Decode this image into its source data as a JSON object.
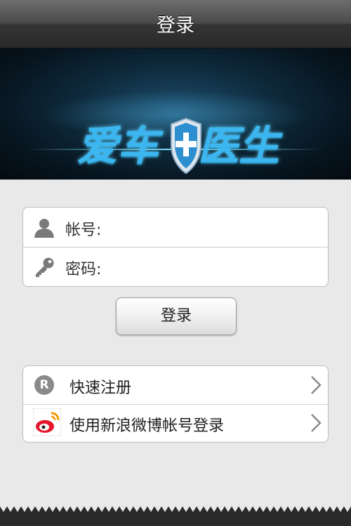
{
  "header": {
    "title": "登录"
  },
  "banner": {
    "logo_left": "爱车",
    "logo_right": "医生"
  },
  "form": {
    "account_label": "帐号:",
    "password_label": "密码:",
    "account_value": "",
    "password_value": ""
  },
  "login_button": {
    "label": "登录"
  },
  "options": [
    {
      "label": "快速注册",
      "icon": "register-r-icon"
    },
    {
      "label": "使用新浪微博帐号登录",
      "icon": "weibo-icon"
    }
  ],
  "colors": {
    "accent": "#3bb6f0",
    "header_bg": "#3a3a3a",
    "page_bg": "#e9e9e9"
  }
}
